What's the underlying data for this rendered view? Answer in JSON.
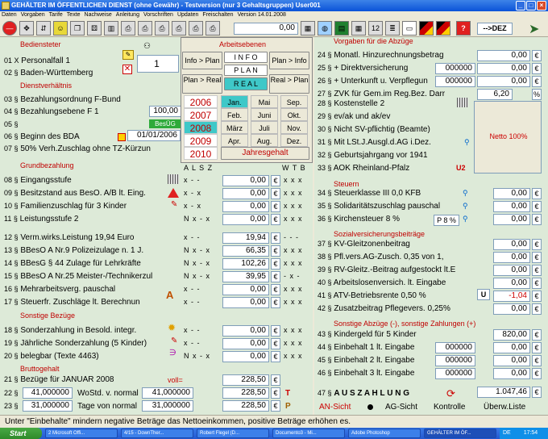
{
  "window": {
    "title": "GEHÄLTER IM ÖFFENTLICHEN DIENST (ohne Gewähr) - Testversion (nur 3 Gehaltsgruppen)   User001"
  },
  "menu": [
    "Daten",
    "Vorgaben",
    "Tarife",
    "Texte",
    "Nachweise",
    "Anleitung",
    "Vorschriften",
    "Updaten",
    "Freischalten",
    "Version 14.01.2008"
  ],
  "toolbar": {
    "counter": "0,00",
    "dez": "-->DEZ"
  },
  "left": {
    "bediensteter": "Bediensteter",
    "rows1": [
      {
        "n": "01 X",
        "t": "Personalfall 1"
      },
      {
        "n": "02 §",
        "t": "Baden-Württemberg"
      }
    ],
    "spinner": "1",
    "dienst": "Dienstverhältnis",
    "rows2": [
      {
        "n": "03 §",
        "t": "Bezahlungsordnung F-Bund"
      },
      {
        "n": "04 §",
        "t": "Bezahlungsebene F 1"
      },
      {
        "n": "05 §",
        "t": ""
      },
      {
        "n": "06 §",
        "t": "Beginn des BDA"
      },
      {
        "n": "07 §",
        "t": "50% Verh.Zuschlag ohne TZ-Kürzun"
      }
    ],
    "val04": "100,00",
    "besug": "BesÜG",
    "date06": "01/01/2006",
    "grund": "Grundbezahlung",
    "alsz": "A L S Z",
    "wtb": "W T B",
    "rows3": [
      {
        "n": "08 §",
        "t": "Eingangsstufe",
        "x": "x - -",
        "v": "0,00",
        "w": "x x x"
      },
      {
        "n": "09 §",
        "t": "Besitzstand aus BesO. A/B lt. Eing.",
        "x": "x - x",
        "v": "0,00",
        "w": "x x x"
      },
      {
        "n": "10 §",
        "t": "Familienzuschlag für 3 Kinder",
        "x": "x - x",
        "v": "0,00",
        "w": "x x x"
      },
      {
        "n": "11 §",
        "t": "Leistungsstufe 2",
        "x": "N x - x",
        "v": "0,00",
        "w": "x x x"
      }
    ],
    "rows4": [
      {
        "n": "12 §",
        "t": "Verm.wirks.Leistung    19,94 Euro",
        "x": "x - -",
        "v": "19,94",
        "w": "- - -"
      },
      {
        "n": "13 §",
        "t": "BBesO A Nr.9 Polizeizulage n. 1 J.",
        "x": "N x - x",
        "v": "66,35",
        "w": "x x x"
      },
      {
        "n": "14 §",
        "t": "BBesG § 44 Zulage für Lehrkräfte",
        "x": "N x - x",
        "v": "102,26",
        "w": "x x x"
      },
      {
        "n": "15 §",
        "t": "BBesO A Nr.25 Meister-/Technikerzul",
        "x": "N x - x",
        "v": "39,95",
        "w": "- x -"
      },
      {
        "n": "16 §",
        "t": "Mehrarbeitsverg. pauschal",
        "x": "x - -",
        "v": "0,00",
        "w": "x x x"
      },
      {
        "n": "17 §",
        "t": "Steuerfr. Zuschläge lt. Berechnun",
        "x": "x - -",
        "v": "0,00",
        "w": "x x x"
      }
    ],
    "sonstige": "Sonstige Bezüge",
    "rows5": [
      {
        "n": "18 §",
        "t": "Sonderzahlung in Besold. integr.",
        "x": "x - -",
        "v": "0,00",
        "w": "x x x"
      },
      {
        "n": "19 §",
        "t": "Jährliche Sonderzahlung (5 Kinder)",
        "x": "x - -",
        "v": "0,00",
        "w": "x x x"
      },
      {
        "n": "20 §",
        "t": "belegbar (Texte 4463)",
        "x": "N x - x",
        "v": "0,00",
        "w": "x x x"
      }
    ],
    "brutto": "Bruttogehalt",
    "r21": {
      "n": "21 §",
      "t": "Bezüge für JANUAR  2008",
      "voll": "voll=",
      "v": "228,50"
    },
    "r22": {
      "n": "22 §",
      "a": "41,000000",
      "t": "WoStd. v. normal",
      "b": "41,000000",
      "v": "228,50"
    },
    "r23": {
      "n": "23 §",
      "a": "31,000000",
      "t": "Tage von normal",
      "b": "31,000000",
      "v": "228,50"
    }
  },
  "popup": {
    "title": "Arbeitsebenen",
    "info_plan": "Info > Plan",
    "info": "I N F O",
    "plan_info": "Plan > Info",
    "plan": "P L A N",
    "plan_real": "Plan > Real",
    "real": "R E A L",
    "real_plan": "Real > Plan",
    "years": [
      "2006",
      "2007",
      "2008",
      "2009",
      "2010"
    ],
    "months": [
      "Jan.",
      "Mai",
      "Sep.",
      "Feb.",
      "Juni",
      "Okt.",
      "März",
      "Juli",
      "Nov.",
      "Apr.",
      "Aug.",
      "Dez."
    ],
    "jahresgehalt": "Jahresgehalt"
  },
  "right": {
    "vorgaben": "Vorgaben für die Abzüge",
    "rows1": [
      {
        "n": "24 §",
        "t": "Monatl. Hinzurechnungsbetrag",
        "v": "0,00",
        "pre": ""
      },
      {
        "n": "25 §",
        "t": "+ Direktversicherung",
        "v": "0,00",
        "pre": "000000"
      },
      {
        "n": "26 §",
        "t": "+ Unterkunft u. Verpflegun",
        "v": "0,00",
        "pre": "000000"
      },
      {
        "n": "27 §",
        "t": "ZVK für Gem.im Reg.Bez. Darr",
        "v": "6,20",
        "pre": "",
        "u": "%",
        "v2": "0,00"
      }
    ],
    "rows2": [
      {
        "n": "28 §",
        "t": "Kostenstelle 2"
      },
      {
        "n": "29 §",
        "t": "ev/ak und ak/ev"
      },
      {
        "n": "30 §",
        "t": "Nicht SV-pflichtig (Beamte)"
      },
      {
        "n": "31 §",
        "t": "Mit LSt.J.Ausgl.d.AG i.Dez."
      },
      {
        "n": "32 §",
        "t": "Geburtsjahrgang vor 1941"
      },
      {
        "n": "33 §",
        "t": "AOK Rheinland-Pfalz"
      }
    ],
    "netto": "Netto   100%",
    "steuern": "Steuern",
    "rows3": [
      {
        "n": "34 §",
        "t": "Steuerklasse III     0,0 KFB",
        "v": "0,00"
      },
      {
        "n": "35 §",
        "t": "Solidaritätszuschlag pauschal",
        "v": "0,00"
      },
      {
        "n": "36 §",
        "t": "Kirchensteuer 8 %",
        "v": "0,00",
        "p": "P 8 %"
      }
    ],
    "sv": "Sozialversicherungsbeiträge",
    "rows4": [
      {
        "n": "37 §",
        "t": "KV-Gleitzonenbeitrag",
        "v": "0,00"
      },
      {
        "n": "38 §",
        "t": "Pfl.vers.AG-Zusch. 0,35 von 1,",
        "v": "0,00"
      },
      {
        "n": "39 §",
        "t": "RV-Gleitz.-Beitrag aufgestockt lt.E",
        "v": "0,00"
      },
      {
        "n": "40 §",
        "t": "Arbeitslosenversich. lt. Eingabe",
        "v": "0,00"
      },
      {
        "n": "41 §",
        "t": "ATV-Betriebsrente 0,50 %",
        "v": "-1,04",
        "u": "U"
      },
      {
        "n": "42 §",
        "t": "Zusatzbeitrag Pflegevers. 0,25%",
        "v": "0,00"
      }
    ],
    "sonst": "Sonstige Abzüge (-), sonstige Zahlungen (+)",
    "rows5": [
      {
        "n": "43 §",
        "t": "Kindergeld für 5 Kinder",
        "v": "820,00",
        "pre": ""
      },
      {
        "n": "44 §",
        "t": "Einbehalt 1 lt. Eingabe",
        "v": "0,00",
        "pre": "000000"
      },
      {
        "n": "45 §",
        "t": "Einbehalt 2 lt. Eingabe",
        "v": "0,00",
        "pre": "000000"
      },
      {
        "n": "46 §",
        "t": "Einbehalt 3 lt. Eingabe",
        "v": "0,00",
        "pre": "000000"
      }
    ],
    "r47": {
      "n": "47 §",
      "t": "A U S Z A H L U N G",
      "v": "1.047,46"
    },
    "bottom": [
      "AN-Sicht",
      "AG-Sicht",
      "Kontrolle",
      "Überw.Liste"
    ]
  },
  "status": "Unter \"Einbehalte\" mindern negative Beträge das Nettoeinkommen, positive Beträge erhöhen es.",
  "taskbar": {
    "start": "Start",
    "items": [
      "2 Microsoft Offi...",
      "4/15 - DownTher...",
      "Robert Flegel (D...",
      "Documento3 - Mi...",
      "Adobe Photoshop",
      "GEHÄLTER IM ÖF..."
    ],
    "lang": "DE",
    "time": "17:54"
  },
  "colors": {
    "section": "#c00000",
    "panel": "#ddead8",
    "popup": "#ece9d8",
    "real": "#3fc8c8"
  }
}
